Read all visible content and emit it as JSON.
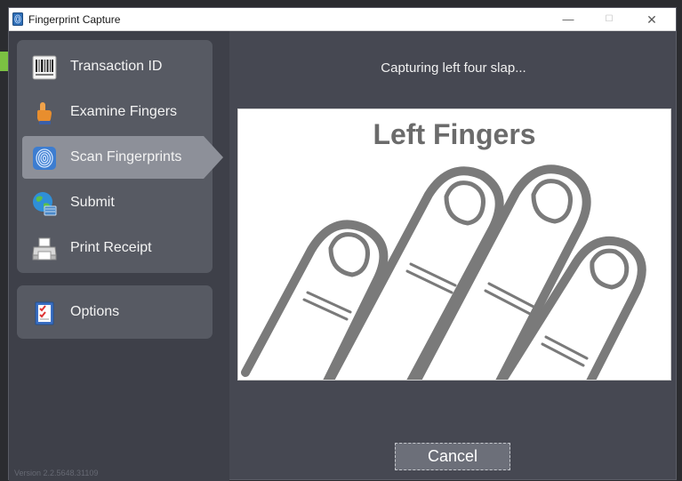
{
  "window": {
    "title": "Fingerprint Capture",
    "controls": {
      "minimize": "—",
      "maximize": "☐",
      "close": "✕"
    }
  },
  "sidebar": {
    "items": [
      {
        "label": "Transaction ID",
        "icon": "barcode-icon"
      },
      {
        "label": "Examine Fingers",
        "icon": "hand-icon"
      },
      {
        "label": "Scan Fingerprints",
        "icon": "fingerprint-icon",
        "active": true
      },
      {
        "label": "Submit",
        "icon": "globe-icon"
      },
      {
        "label": "Print Receipt",
        "icon": "printer-icon"
      }
    ],
    "options": {
      "label": "Options",
      "icon": "checklist-icon"
    },
    "version": "Version 2.2.5648.31109"
  },
  "main": {
    "status": "Capturing left four slap...",
    "capture_title": "Left Fingers",
    "cancel_label": "Cancel"
  },
  "colors": {
    "window_bg": "#464852",
    "sidebar_bg": "#3e4049",
    "panel_bg": "#575a63",
    "active_item": "#8d9099",
    "accent_green": "#7bc142"
  }
}
